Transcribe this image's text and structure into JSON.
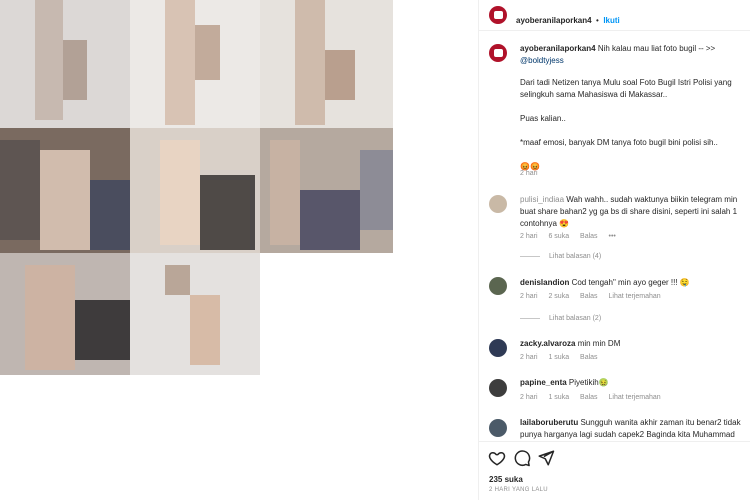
{
  "post": {
    "username": "ayoberanilaporkan4",
    "dot": "•",
    "follow_label": "Ikuti",
    "caption_lines": [
      "Nih kalau mau liat foto bugil -- >>",
      "@boldtyjess"
    ],
    "body_lines": [
      "Dari tadi Netizen tanya Mulu soal Foto Bugil Istri Polisi yang",
      "selingkuh sama Mahasiswa di Makassar..",
      "Puas kalian..",
      "*maaf emosi, banyak DM tanya foto bugil bini polisi sih..",
      "😡😡"
    ],
    "caption_time": "2 hari",
    "likes": "235 suka",
    "date": "2 HARI YANG LALU"
  },
  "comments": [
    {
      "user": "pulisi_indiaa",
      "text_lines": [
        "Wah wahh.. sudah waktunya biikin telegram min",
        "buat share bahan2 yg ga bs di share disini, seperti ini salah 1",
        "contohnya 😍"
      ],
      "time": "2 hari",
      "likes": "6 suka",
      "reply": "Balas",
      "more": "•••",
      "view_replies": "Lihat balasan (4)",
      "avatar_color": "#c9b9a6"
    },
    {
      "user": "denislandion",
      "text_lines": [
        "Cod tengah\" min ayo geger !!! 🤤"
      ],
      "time": "2 hari",
      "likes": "2 suka",
      "reply": "Balas",
      "translate": "Lihat terjemahan",
      "view_replies": "Lihat balasan (2)",
      "avatar_color": "#5b6650"
    },
    {
      "user": "zacky.alvaroza",
      "text_lines": [
        "min min DM"
      ],
      "time": "2 hari",
      "likes": "1 suka",
      "reply": "Balas",
      "avatar_color": "#2f3a55"
    },
    {
      "user": "papine_enta",
      "text_lines": [
        "Piyetikih🤢"
      ],
      "time": "2 hari",
      "likes": "1 suka",
      "reply": "Balas",
      "translate": "Lihat terjemahan",
      "avatar_color": "#3d3d3d"
    },
    {
      "user": "lailaboruberutu",
      "text_lines": [
        "Sungguh wanita akhir zaman itu benar2 tidak",
        "punya harganya lagi sudah capek2 Baginda kita Muhammad"
      ],
      "avatar_color": "#4b5a68"
    }
  ],
  "icons": {
    "like": "heart-icon",
    "comment": "comment-icon",
    "share": "share-icon"
  },
  "colors": {
    "brand": "#b0122a",
    "link": "#0095f6",
    "muted": "#8e8e8e"
  }
}
